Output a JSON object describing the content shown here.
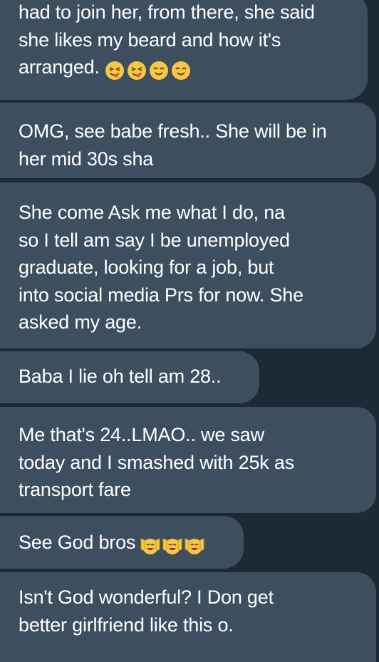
{
  "messages": [
    {
      "text": "had to join her, from there, she said\nshe likes my beard and how it's\narranged.",
      "emojis": [
        "squinting-face-with-tongue-icon",
        "squinting-face-with-tongue-icon",
        "smiling-eyes-face-icon",
        "smiling-eyes-face-icon"
      ]
    },
    {
      "text": "OMG, see babe fresh.. She will be in\nher mid 30s sha"
    },
    {
      "text": "She come Ask me what I do, na\nso I tell am say I be unemployed\ngraduate, looking for a job, but\ninto social media Prs for now.  She\nasked my age."
    },
    {
      "text": "Baba I lie oh tell am 28.."
    },
    {
      "text": "Me that's 24..LMAO..  we saw\ntoday and I smashed with 25k as\ntransport fare"
    },
    {
      "text": "See God bros",
      "emojis": [
        "raising-hands-face-icon",
        "raising-hands-face-icon",
        "raising-hands-face-icon"
      ]
    },
    {
      "text": "Isn't God wonderful? I Don get\nbetter girlfriend like this o."
    }
  ],
  "colors": {
    "background": "#1d2a36",
    "bubble": "#3d4f5f",
    "text": "#ffffff",
    "emoji_face": "#f7c843"
  }
}
